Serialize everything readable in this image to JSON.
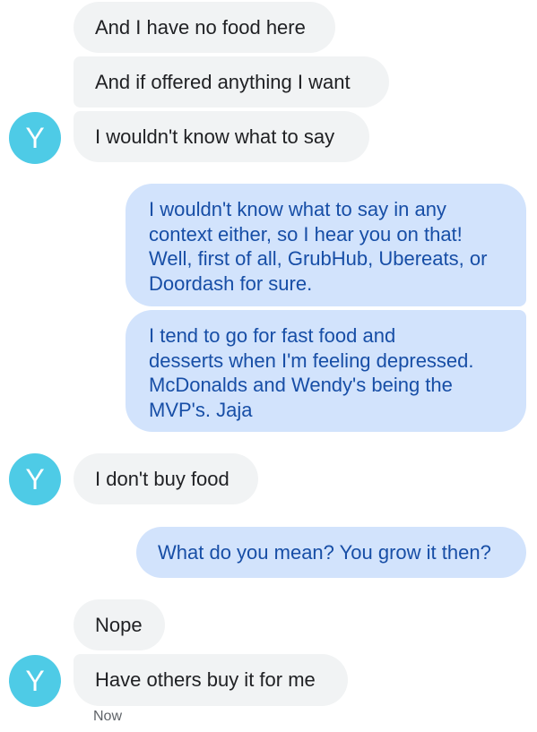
{
  "avatar_letter": "Y",
  "colors": {
    "incoming_bubble": "#f1f3f4",
    "outgoing_bubble": "#d2e3fc",
    "outgoing_text": "#174ea6",
    "avatar": "#4ecbe6"
  },
  "messages": [
    {
      "direction": "incoming",
      "text": "And I have no food here"
    },
    {
      "direction": "incoming",
      "text": "And if offered anything I want"
    },
    {
      "direction": "incoming",
      "text": "I wouldn't know what to say"
    },
    {
      "direction": "outgoing",
      "text": "I wouldn't know what to say in any\ncontext either, so I hear you on that!\nWell, first of all, GrubHub, Ubereats, or\nDoordash for sure."
    },
    {
      "direction": "outgoing",
      "text": "I tend to go for fast food and\ndesserts when I'm feeling depressed.\nMcDonalds and Wendy's being the\nMVP's. Jaja"
    },
    {
      "direction": "incoming",
      "text": "I don't buy food"
    },
    {
      "direction": "outgoing",
      "text": "What do you mean? You grow it then?"
    },
    {
      "direction": "incoming",
      "text": "Nope"
    },
    {
      "direction": "incoming",
      "text": "Have others buy it for me"
    }
  ],
  "last_timestamp": "Now"
}
